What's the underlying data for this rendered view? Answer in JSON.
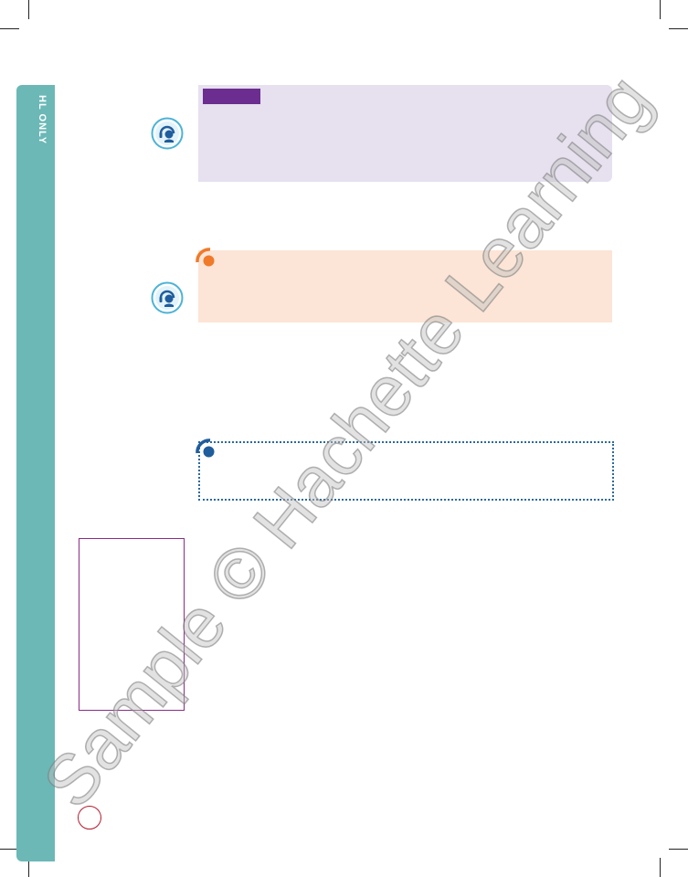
{
  "sidebar": {
    "label": "HL ONLY",
    "color": "#6bb8b6"
  },
  "colors": {
    "purple_box": "#e6e0ef",
    "purple_tab": "#6b2d8f",
    "orange_box": "#fce5d6",
    "orange_marker": "#f07a2a",
    "blue_marker": "#1f5d9c",
    "dotted_border": "#2a6a9c",
    "margin_box_border": "#8a2c86",
    "page_number_circle": "#b5192b"
  },
  "icons": {
    "headset_1": "headset-icon",
    "headset_2": "headset-icon",
    "orange_marker": "orange-dot-marker-icon",
    "blue_marker": "blue-dot-marker-icon"
  },
  "watermark": {
    "text": "Sample © Hachette Learning"
  }
}
